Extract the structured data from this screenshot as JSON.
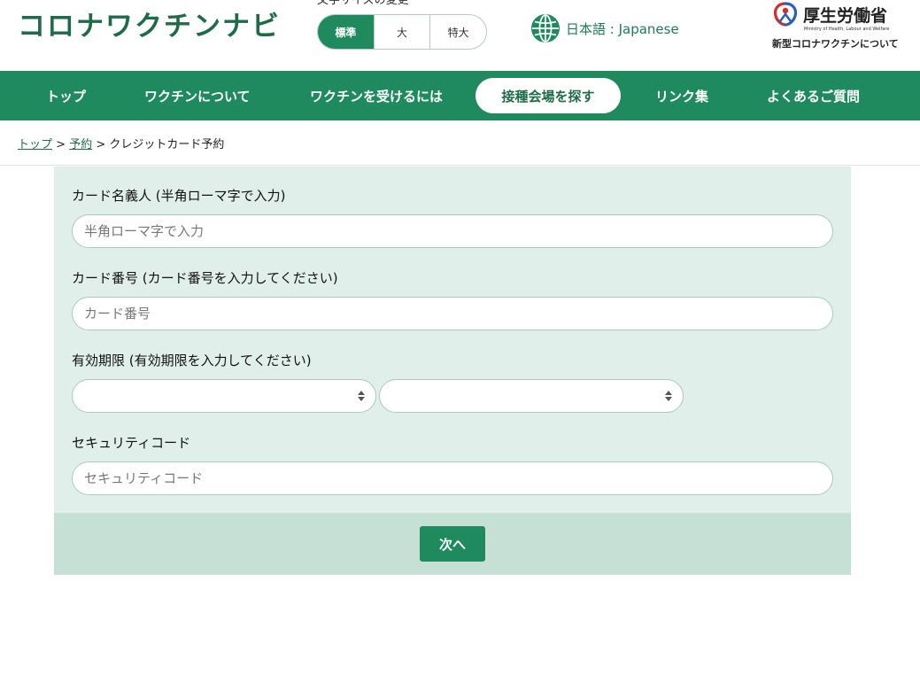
{
  "header": {
    "site_title": "コロナワクチンナビ",
    "fontsize_caption": "文字サイズの変更",
    "fontsize_options": [
      "標準",
      "大",
      "特大"
    ],
    "fontsize_selected": "標準",
    "language_label": "日本語 : Japanese",
    "ministry_name": "厚生労働省",
    "ministry_name_en": "Ministry of Health, Labour and Welfare",
    "ministry_sub": "新型コロナワクチンについて"
  },
  "nav": {
    "items": [
      "トップ",
      "ワクチンについて",
      "ワクチンを受けるには",
      "接種会場を探す",
      "リンク集",
      "よくあるご質問"
    ],
    "active": "接種会場を探す"
  },
  "breadcrumb": {
    "top": "トップ",
    "sep1": " > ",
    "reservation": "予約",
    "sep2": " > ",
    "current": "クレジットカード予約"
  },
  "form": {
    "cardholder_label": "カード名義人 (半角ローマ字で入力)",
    "cardholder_placeholder": "半角ローマ字で入力",
    "card_number_label": "カード番号 (カード番号を入力してください)",
    "card_number_placeholder": "カード番号",
    "expiry_label": "有効期限 (有効期限を入力してください)",
    "security_label": "セキュリティコード",
    "security_placeholder": "セキュリティコード",
    "next_button": "次へ"
  },
  "colors": {
    "brand_green": "#1f8a5e",
    "logo_green": "#1f6b48",
    "panel_bg": "#e0efe9",
    "footer_bg": "#c6e0d6"
  }
}
